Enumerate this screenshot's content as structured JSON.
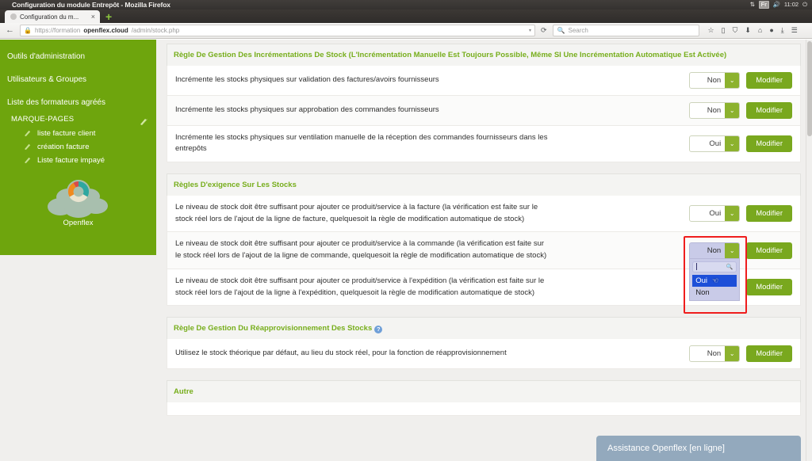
{
  "os": {
    "window_title": "Configuration du module Entrepôt - Mozilla Firefox",
    "tray": {
      "network_icon": "network-arrows-icon",
      "keyboard_layout": "Fr",
      "volume_icon": "volume-icon",
      "clock": "11:02",
      "power_icon": "power-icon"
    }
  },
  "browser": {
    "tab": {
      "label": "Configuration du m...",
      "close_label": "×"
    },
    "new_tab_label": "+",
    "back_label": "←",
    "reload_label": "⟳",
    "url": {
      "lock_icon": "lock-icon",
      "scheme": "https://formation",
      "domain": "openflex.cloud",
      "path": "/admin/stock.php",
      "dropdown_marker": "▾"
    },
    "search": {
      "placeholder": "Search",
      "icon": "search-icon"
    },
    "toolbar_icons": [
      {
        "name": "bookmark-star-icon",
        "glyph": "☆"
      },
      {
        "name": "reader-view-icon",
        "glyph": "▯"
      },
      {
        "name": "shield-icon",
        "glyph": "⛉"
      },
      {
        "name": "save-page-icon",
        "glyph": "⬇"
      },
      {
        "name": "home-icon",
        "glyph": "⌂"
      },
      {
        "name": "chat-icon",
        "glyph": "●"
      },
      {
        "name": "downloads-icon",
        "glyph": "⤓"
      },
      {
        "name": "menu-icon",
        "glyph": "☰"
      }
    ]
  },
  "sidebar": {
    "links": [
      {
        "label": "Outils d'administration"
      },
      {
        "label": "Utilisateurs & Groupes"
      },
      {
        "label": "Liste des formateurs agréés"
      }
    ],
    "bookmarks": {
      "title": "MARQUE-PAGES",
      "header_icon": "bookmark-icon",
      "items": [
        {
          "label": "liste facture client",
          "icon": "bookmark-icon"
        },
        {
          "label": "création facture",
          "icon": "bookmark-icon"
        },
        {
          "label": "Liste facture impayé",
          "icon": "bookmark-icon"
        }
      ]
    },
    "logo": {
      "icon": "openflex-cloud-logo",
      "caption": "Openflex"
    },
    "color": "#6ea50d"
  },
  "main": {
    "button_label": "Modifier",
    "sections": [
      {
        "title": "Règle De Gestion Des Incrémentations De Stock (L'Incrémentation Manuelle Est Toujours Possible, Même SI Une Incrémentation Automatique Est Activée)",
        "help": null,
        "rows": [
          {
            "label": "Incrémente les stocks physiques sur validation des factures/avoirs fournisseurs",
            "value": "Non",
            "action": "Modifier"
          },
          {
            "label": "Incrémente les stocks physiques sur approbation des commandes fournisseurs",
            "value": "Non",
            "action": "Modifier"
          },
          {
            "label": "Incrémente les stocks physiques sur ventilation manuelle de la réception des commandes fournisseurs dans les entrepôts",
            "value": "Oui",
            "action": "Modifier"
          }
        ]
      },
      {
        "title": "Règles D'exigence Sur Les Stocks",
        "help": null,
        "rows": [
          {
            "label": "Le niveau de stock doit être suffisant pour ajouter ce produit/service à la facture (la vérification est faite sur le stock réel lors de l'ajout de la ligne de facture, quelquesoit la règle de modification automatique de stock)",
            "value": "Oui",
            "action": "Modifier"
          },
          {
            "label": "Le niveau de stock doit être suffisant pour ajouter ce produit/service à la commande (la vérification est faite sur le stock réel lors de l'ajout de la ligne de commande, quelquesoit la règle de modification automatique de stock)",
            "value": "Non",
            "action": "Modifier",
            "dropdown_open": true
          },
          {
            "label": "Le niveau de stock doit être suffisant pour ajouter ce produit/service à l'expédition (la vérification est faite sur le stock réel lors de l'ajout de la ligne à l'expédition, quelquesoit la règle de modification automatique de stock)",
            "value": "",
            "action": "Modifier"
          }
        ]
      },
      {
        "title": "Règle De Gestion Du Réapprovisionnement Des Stocks",
        "help": "?",
        "rows": [
          {
            "label": "Utilisez le stock théorique par défaut, au lieu du stock réel, pour la fonction de réapprovisionnement",
            "value": "Non",
            "action": "Modifier"
          }
        ]
      },
      {
        "title": "Autre",
        "help": null,
        "rows": []
      }
    ],
    "open_dropdown": {
      "current_value": "Non",
      "chevron": "⌄",
      "search_value": "",
      "search_icon": "search-icon",
      "options": [
        {
          "label": "Oui",
          "selected": true
        },
        {
          "label": "Non",
          "selected": false
        }
      ],
      "cursor_icon": "hand-cursor",
      "highlight_color": "#ef1d1d"
    }
  },
  "chat_widget": {
    "label": "Assistance Openflex [en ligne]",
    "color": "#93a9bd"
  }
}
